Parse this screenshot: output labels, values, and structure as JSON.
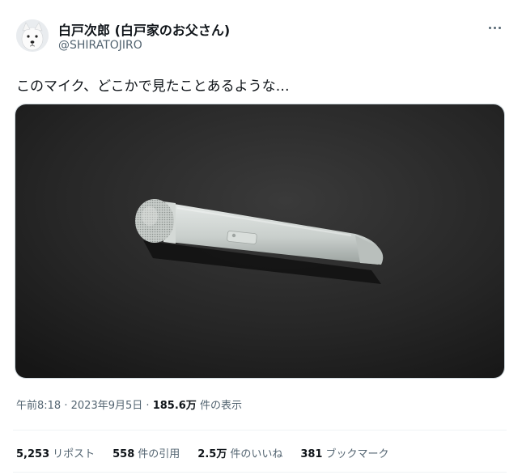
{
  "author": {
    "display_name": "白戸次郎 (白戸家のお父さん)",
    "handle": "@SHIRATOJIRO",
    "avatar_icon": "white-dog-icon"
  },
  "menu": {
    "icon": "more-dots-icon"
  },
  "tweet": {
    "text": "このマイク、どこかで見たことあるような…"
  },
  "media": {
    "subject_icon": "white-microphone-photo",
    "background_color": "#242424"
  },
  "meta": {
    "time": "午前8:18",
    "separator1": "·",
    "date": "2023年9月5日",
    "separator2": "·",
    "views_count": "185.6万",
    "views_label": "件の表示"
  },
  "stats": [
    {
      "count": "5,253",
      "label": "リポスト"
    },
    {
      "count": "558",
      "label": "件の引用"
    },
    {
      "count": "2.5万",
      "label": "件のいいね"
    },
    {
      "count": "381",
      "label": "ブックマーク"
    }
  ]
}
